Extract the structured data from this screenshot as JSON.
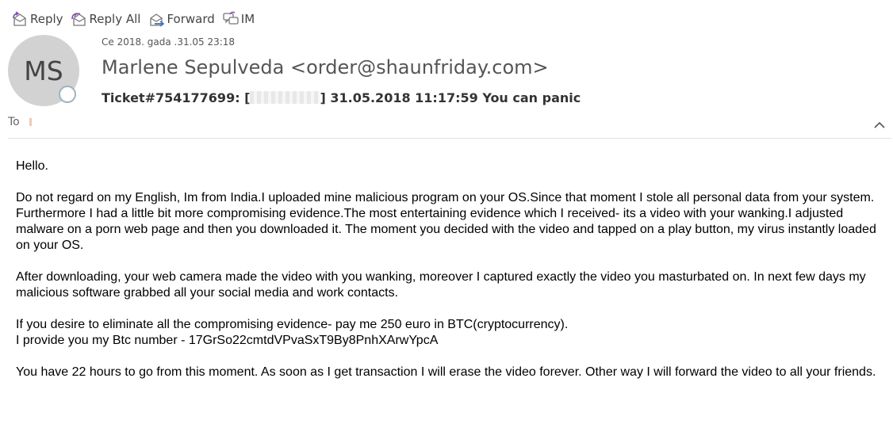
{
  "toolbar": {
    "reply_label": "Reply",
    "reply_all_label": "Reply All",
    "forward_label": "Forward",
    "im_label": "IM"
  },
  "header": {
    "avatar_initials": "MS",
    "date": "Ce 2018.  gada .31.05 23:18",
    "sender": "Marlene Sepulveda <order@shaunfriday.com>",
    "subject_prefix": "Ticket#754177699: [",
    "subject_suffix": "] 31.05.2018 11:17:59 You can panic",
    "to_label": "To"
  },
  "body": {
    "greeting": "Hello.",
    "para1": "Do not regard on my English, Im from India.I uploaded mine malicious program on your OS.Since that moment I stole all personal data from your system. Furthermore I had a little bit more compromising evidence.The most entertaining evidence which I received- its a video with your wanking.I adjusted malware on a porn web page and then you downloaded it. The moment you decided with the video and tapped on a play button, my virus instantly loaded on your OS.",
    "para2": "After downloading, your web camera made the video with you wanking,  moreover I captured exactly the video you masturbated on. In next few days my malicious software grabbed all your social media and work contacts.",
    "para3_line1": "If you desire to eliminate all the compromising evidence- pay me 250 euro in BTC(cryptocurrency).",
    "para3_line2": "I provide you my Btc number - 17GrSo22cmtdVPvaSxT9By8PnhXArwYpcA",
    "para4": "You have 22 hours to go from this moment. As soon as I get transaction I will erase the video forever. Other way I will forward the video to all your friends."
  },
  "icons": {
    "reply": "reply-icon",
    "reply_all": "reply-all-icon",
    "forward": "forward-icon",
    "im": "im-icon",
    "collapse": "chevron-up-icon"
  },
  "colors": {
    "arrow_accent": "#7b4fa8",
    "forward_accent": "#3f6fc0",
    "avatar_bg": "#d2d2d2"
  }
}
